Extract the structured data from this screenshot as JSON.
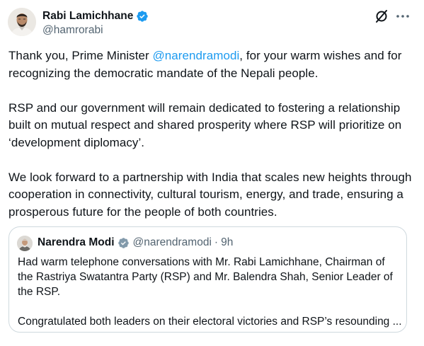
{
  "author": {
    "name": "Rabi Lamichhane",
    "handle": "@hamrorabi"
  },
  "icons": {
    "verified": "verified-badge-icon",
    "grok": "grok-icon",
    "more": "more-options-icon"
  },
  "colors": {
    "accent": "#1d9bf0",
    "secondary_text": "#536471",
    "border": "#cfd9de"
  },
  "tweet": {
    "p1_before": "Thank you, Prime Minister ",
    "p1_mention": "@narendramodi",
    "p1_after": ", for your warm wishes and for recognizing the democratic mandate of the Nepali people.",
    "p2": "RSP and our government will remain dedicated to fostering a relationship built on mutual respect and shared prosperity where RSP will prioritize on ‘development diplomacy’.",
    "p3": "We look forward to a partnership with India that scales new heights through cooperation in connectivity, cultural tourism, energy, and trade, ensuring a prosperous future for the people of both countries."
  },
  "quote": {
    "name": "Narendra Modi",
    "handle": "@narendramodi",
    "separator": "·",
    "time": "9h",
    "p1": "Had warm telephone conversations with Mr. Rabi Lamichhane, Chairman of the Rastriya Swatantra Party (RSP) and Mr. Balendra Shah, Senior Leader of the RSP.",
    "p2": "Congratulated both leaders on their electoral victories and RSP’s resounding ..."
  }
}
